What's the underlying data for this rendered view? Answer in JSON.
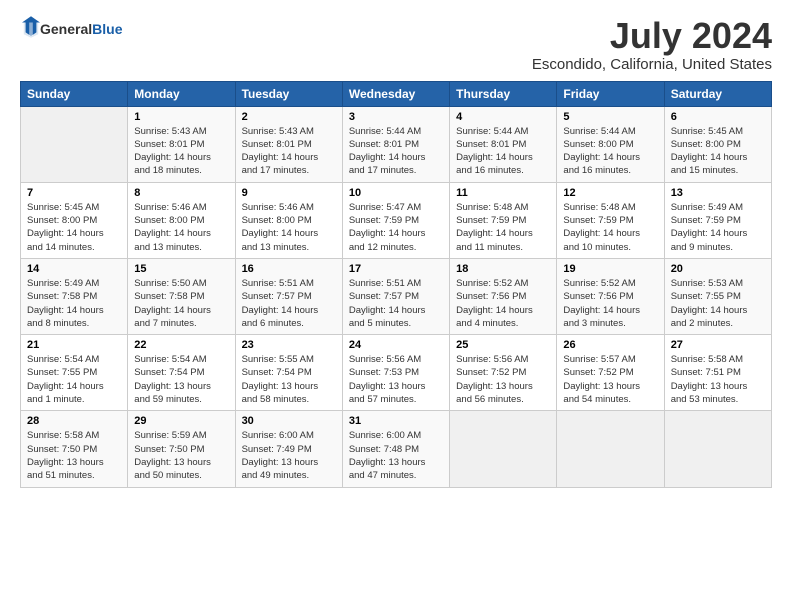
{
  "logo": {
    "general": "General",
    "blue": "Blue"
  },
  "title": "July 2024",
  "subtitle": "Escondido, California, United States",
  "days_header": [
    "Sunday",
    "Monday",
    "Tuesday",
    "Wednesday",
    "Thursday",
    "Friday",
    "Saturday"
  ],
  "weeks": [
    [
      {
        "num": "",
        "info": ""
      },
      {
        "num": "1",
        "info": "Sunrise: 5:43 AM\nSunset: 8:01 PM\nDaylight: 14 hours\nand 18 minutes."
      },
      {
        "num": "2",
        "info": "Sunrise: 5:43 AM\nSunset: 8:01 PM\nDaylight: 14 hours\nand 17 minutes."
      },
      {
        "num": "3",
        "info": "Sunrise: 5:44 AM\nSunset: 8:01 PM\nDaylight: 14 hours\nand 17 minutes."
      },
      {
        "num": "4",
        "info": "Sunrise: 5:44 AM\nSunset: 8:01 PM\nDaylight: 14 hours\nand 16 minutes."
      },
      {
        "num": "5",
        "info": "Sunrise: 5:44 AM\nSunset: 8:00 PM\nDaylight: 14 hours\nand 16 minutes."
      },
      {
        "num": "6",
        "info": "Sunrise: 5:45 AM\nSunset: 8:00 PM\nDaylight: 14 hours\nand 15 minutes."
      }
    ],
    [
      {
        "num": "7",
        "info": "Sunrise: 5:45 AM\nSunset: 8:00 PM\nDaylight: 14 hours\nand 14 minutes."
      },
      {
        "num": "8",
        "info": "Sunrise: 5:46 AM\nSunset: 8:00 PM\nDaylight: 14 hours\nand 13 minutes."
      },
      {
        "num": "9",
        "info": "Sunrise: 5:46 AM\nSunset: 8:00 PM\nDaylight: 14 hours\nand 13 minutes."
      },
      {
        "num": "10",
        "info": "Sunrise: 5:47 AM\nSunset: 7:59 PM\nDaylight: 14 hours\nand 12 minutes."
      },
      {
        "num": "11",
        "info": "Sunrise: 5:48 AM\nSunset: 7:59 PM\nDaylight: 14 hours\nand 11 minutes."
      },
      {
        "num": "12",
        "info": "Sunrise: 5:48 AM\nSunset: 7:59 PM\nDaylight: 14 hours\nand 10 minutes."
      },
      {
        "num": "13",
        "info": "Sunrise: 5:49 AM\nSunset: 7:59 PM\nDaylight: 14 hours\nand 9 minutes."
      }
    ],
    [
      {
        "num": "14",
        "info": "Sunrise: 5:49 AM\nSunset: 7:58 PM\nDaylight: 14 hours\nand 8 minutes."
      },
      {
        "num": "15",
        "info": "Sunrise: 5:50 AM\nSunset: 7:58 PM\nDaylight: 14 hours\nand 7 minutes."
      },
      {
        "num": "16",
        "info": "Sunrise: 5:51 AM\nSunset: 7:57 PM\nDaylight: 14 hours\nand 6 minutes."
      },
      {
        "num": "17",
        "info": "Sunrise: 5:51 AM\nSunset: 7:57 PM\nDaylight: 14 hours\nand 5 minutes."
      },
      {
        "num": "18",
        "info": "Sunrise: 5:52 AM\nSunset: 7:56 PM\nDaylight: 14 hours\nand 4 minutes."
      },
      {
        "num": "19",
        "info": "Sunrise: 5:52 AM\nSunset: 7:56 PM\nDaylight: 14 hours\nand 3 minutes."
      },
      {
        "num": "20",
        "info": "Sunrise: 5:53 AM\nSunset: 7:55 PM\nDaylight: 14 hours\nand 2 minutes."
      }
    ],
    [
      {
        "num": "21",
        "info": "Sunrise: 5:54 AM\nSunset: 7:55 PM\nDaylight: 14 hours\nand 1 minute."
      },
      {
        "num": "22",
        "info": "Sunrise: 5:54 AM\nSunset: 7:54 PM\nDaylight: 13 hours\nand 59 minutes."
      },
      {
        "num": "23",
        "info": "Sunrise: 5:55 AM\nSunset: 7:54 PM\nDaylight: 13 hours\nand 58 minutes."
      },
      {
        "num": "24",
        "info": "Sunrise: 5:56 AM\nSunset: 7:53 PM\nDaylight: 13 hours\nand 57 minutes."
      },
      {
        "num": "25",
        "info": "Sunrise: 5:56 AM\nSunset: 7:52 PM\nDaylight: 13 hours\nand 56 minutes."
      },
      {
        "num": "26",
        "info": "Sunrise: 5:57 AM\nSunset: 7:52 PM\nDaylight: 13 hours\nand 54 minutes."
      },
      {
        "num": "27",
        "info": "Sunrise: 5:58 AM\nSunset: 7:51 PM\nDaylight: 13 hours\nand 53 minutes."
      }
    ],
    [
      {
        "num": "28",
        "info": "Sunrise: 5:58 AM\nSunset: 7:50 PM\nDaylight: 13 hours\nand 51 minutes."
      },
      {
        "num": "29",
        "info": "Sunrise: 5:59 AM\nSunset: 7:50 PM\nDaylight: 13 hours\nand 50 minutes."
      },
      {
        "num": "30",
        "info": "Sunrise: 6:00 AM\nSunset: 7:49 PM\nDaylight: 13 hours\nand 49 minutes."
      },
      {
        "num": "31",
        "info": "Sunrise: 6:00 AM\nSunset: 7:48 PM\nDaylight: 13 hours\nand 47 minutes."
      },
      {
        "num": "",
        "info": ""
      },
      {
        "num": "",
        "info": ""
      },
      {
        "num": "",
        "info": ""
      }
    ]
  ]
}
